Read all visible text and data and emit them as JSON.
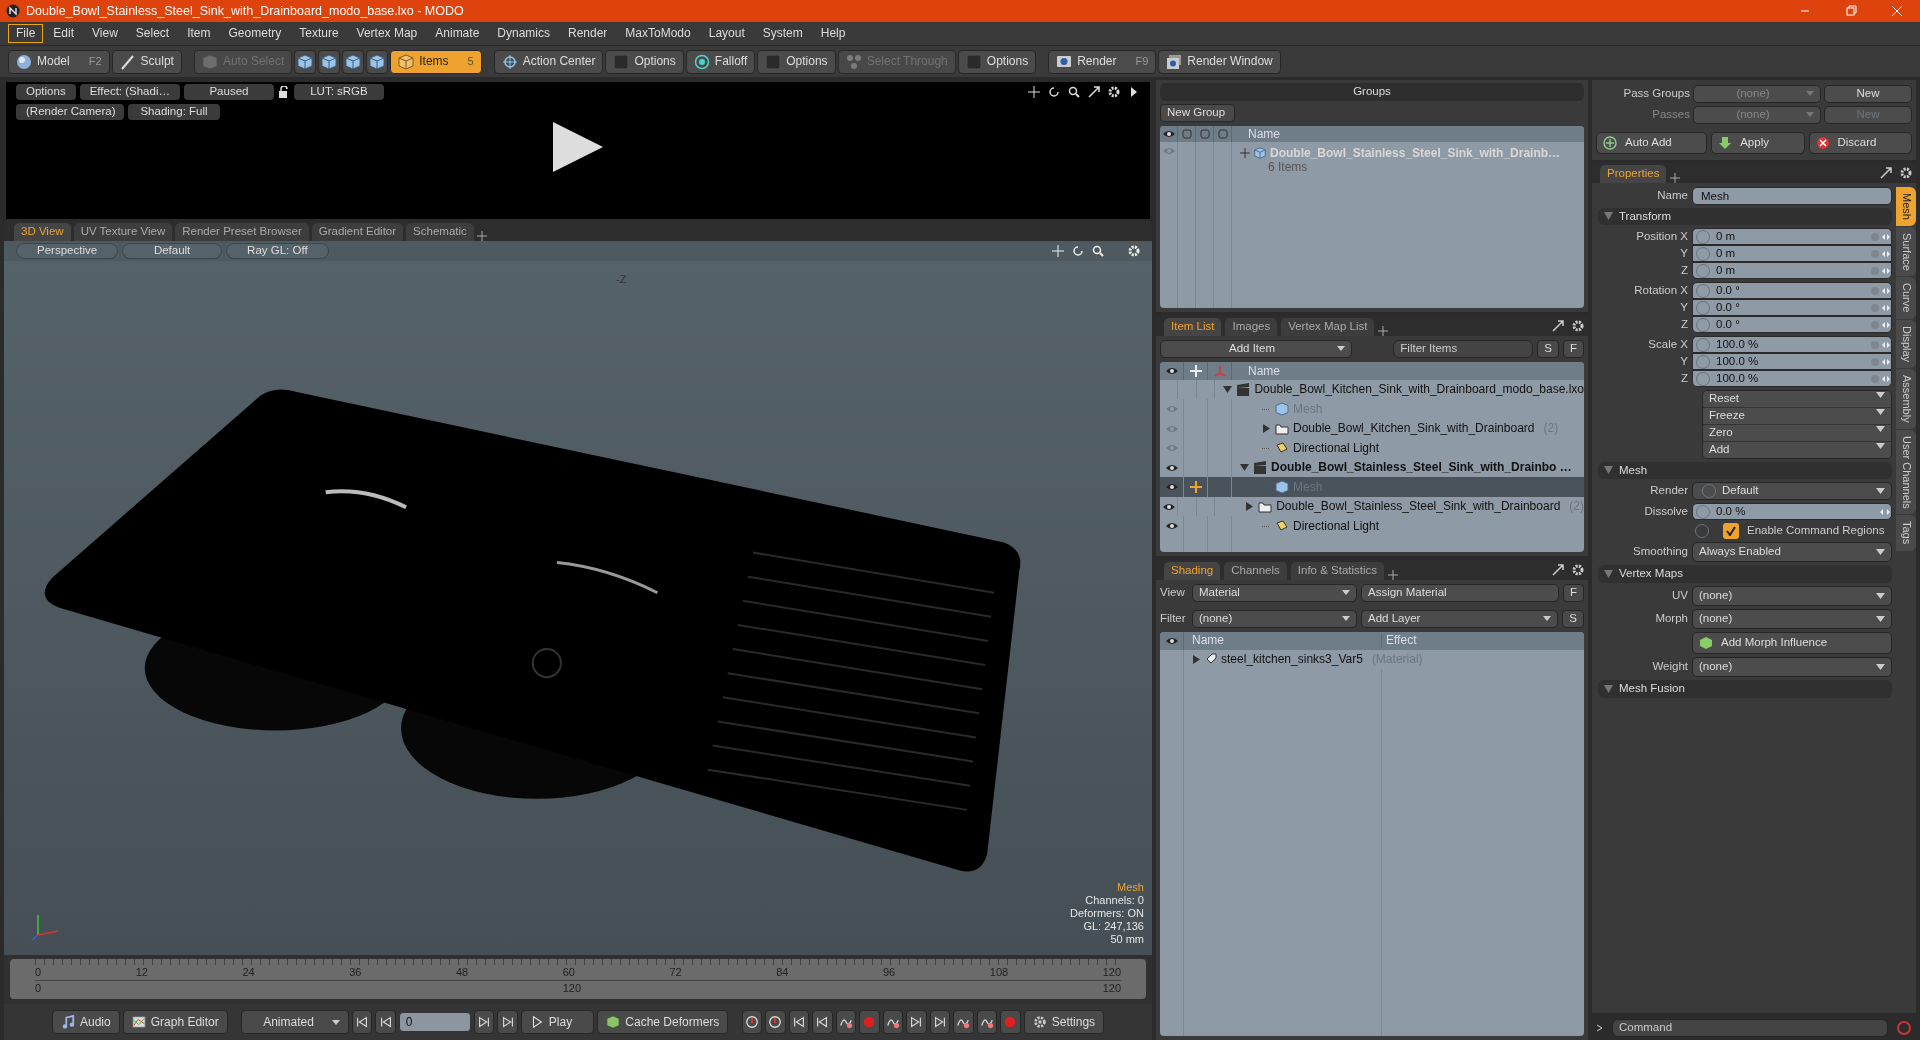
{
  "window": {
    "title": "Double_Bowl_Stainless_Steel_Sink_with_Drainboard_modo_base.lxo - MODO"
  },
  "menus": [
    {
      "label": "File",
      "selected": true
    },
    {
      "label": "Edit",
      "selected": false
    },
    {
      "label": "View",
      "selected": false
    },
    {
      "label": "Select",
      "selected": false
    },
    {
      "label": "Item",
      "selected": false
    },
    {
      "label": "Geometry",
      "selected": false
    },
    {
      "label": "Texture",
      "selected": false
    },
    {
      "label": "Vertex Map",
      "selected": false
    },
    {
      "label": "Animate",
      "selected": false
    },
    {
      "label": "Dynamics",
      "selected": false
    },
    {
      "label": "Render",
      "selected": false
    },
    {
      "label": "MaxToModo",
      "selected": false
    },
    {
      "label": "Layout",
      "selected": false
    },
    {
      "label": "System",
      "selected": false
    },
    {
      "label": "Help",
      "selected": false
    }
  ],
  "toolbar": [
    {
      "kind": "button",
      "label": "Model",
      "key": "F2",
      "selected": false,
      "disabled": false
    },
    {
      "kind": "button",
      "label": "Sculpt",
      "selected": false,
      "disabled": false
    },
    {
      "kind": "button",
      "label": "Auto Select",
      "selected": false,
      "disabled": true
    },
    {
      "kind": "icon",
      "selected": false,
      "disabled": false
    },
    {
      "kind": "icon",
      "selected": false,
      "disabled": false
    },
    {
      "kind": "icon",
      "selected": false,
      "disabled": false
    },
    {
      "kind": "icon",
      "selected": false,
      "disabled": false
    },
    {
      "kind": "button",
      "label": "Items",
      "key": "5",
      "selected": true,
      "disabled": false
    },
    {
      "kind": "button",
      "label": "Action Center",
      "selected": false,
      "disabled": false
    },
    {
      "kind": "button",
      "label": "Options",
      "selected": false,
      "disabled": false
    },
    {
      "kind": "button",
      "label": "Falloff",
      "selected": false,
      "disabled": false
    },
    {
      "kind": "button",
      "label": "Options",
      "selected": false,
      "disabled": false
    },
    {
      "kind": "button",
      "label": "Select Through",
      "selected": false,
      "disabled": true
    },
    {
      "kind": "button",
      "label": "Options",
      "selected": false,
      "disabled": false
    },
    {
      "kind": "button",
      "label": "Render",
      "key": "F9",
      "selected": false,
      "disabled": false
    },
    {
      "kind": "button",
      "label": "Render Window",
      "selected": false,
      "disabled": false
    }
  ],
  "preview": {
    "buttons_row1": [
      "Options",
      "Effect: (Shadi…",
      "Paused"
    ],
    "lut": "LUT: sRGB",
    "buttons_row2": [
      "(Render Camera)",
      "Shading: Full"
    ]
  },
  "viewport": {
    "tabs": [
      {
        "label": "3D View",
        "selected": true
      },
      {
        "label": "UV Texture View",
        "selected": false
      },
      {
        "label": "Render Preset Browser",
        "selected": false
      },
      {
        "label": "Gradient Editor",
        "selected": false
      },
      {
        "label": "Schematic",
        "selected": false
      }
    ],
    "buttons": [
      "Perspective",
      "Default",
      "Ray GL: Off"
    ],
    "axis_label": "-Z",
    "info": [
      "Mesh",
      "Channels: 0",
      "Deformers: ON",
      "GL: 247,136",
      "50 mm"
    ]
  },
  "timeline": {
    "ticks": [
      "0",
      "12",
      "24",
      "36",
      "48",
      "60",
      "72",
      "84",
      "96",
      "108",
      "120"
    ],
    "range": [
      "0",
      "120",
      "120"
    ]
  },
  "bottom_bar": [
    {
      "kind": "button",
      "label": "Audio"
    },
    {
      "kind": "button",
      "label": "Graph Editor"
    },
    {
      "kind": "dropdown",
      "label": "Animated"
    },
    {
      "kind": "icon"
    },
    {
      "kind": "icon"
    },
    {
      "kind": "field",
      "label": "0"
    },
    {
      "kind": "icon"
    },
    {
      "kind": "icon"
    },
    {
      "kind": "button",
      "label": "Play"
    },
    {
      "kind": "button",
      "label": "Cache Deformers"
    },
    {
      "kind": "icon"
    },
    {
      "kind": "icon"
    },
    {
      "kind": "icon"
    },
    {
      "kind": "icon"
    },
    {
      "kind": "icon"
    },
    {
      "kind": "icon"
    },
    {
      "kind": "icon"
    },
    {
      "kind": "icon"
    },
    {
      "kind": "icon"
    },
    {
      "kind": "icon"
    },
    {
      "kind": "icon"
    },
    {
      "kind": "icon"
    },
    {
      "kind": "button",
      "label": "Settings"
    }
  ],
  "groups": {
    "title": "Groups",
    "new_button": "New Group",
    "column": "Name",
    "rows": [
      {
        "name": "Double_Bowl_Stainless_Steel_Sink_with_Drainb…",
        "detail": "6 Items"
      }
    ]
  },
  "item_list": {
    "tabs": [
      {
        "label": "Item List",
        "selected": true
      },
      {
        "label": "Images",
        "selected": false
      },
      {
        "label": "Vertex Map List",
        "selected": false
      }
    ],
    "add_button": "Add Item",
    "filter_placeholder": "Filter Items",
    "s_button": "S",
    "f_button": "F",
    "column": "Name",
    "items": [
      {
        "kind": "scene",
        "name": "Double_Bowl_Kitchen_Sink_with_Drainboard_modo_base.lxo",
        "active": false,
        "expanded": true,
        "selected": false,
        "children": [
          {
            "kind": "mesh",
            "name": "Mesh",
            "visible": false,
            "hidden": true,
            "selected": false
          },
          {
            "kind": "folder",
            "name": "Double_Bowl_Kitchen_Sink_with_Drainboard",
            "count": "(2)",
            "visible": false,
            "hidden": false,
            "expanded": false,
            "selected": false
          },
          {
            "kind": "light",
            "name": "Directional Light",
            "visible": false,
            "hidden": false,
            "selected": false
          }
        ]
      },
      {
        "kind": "scene",
        "name": "Double_Bowl_Stainless_Steel_Sink_with_Drainbo …",
        "active": true,
        "expanded": true,
        "visible": true,
        "selected": false,
        "children": [
          {
            "kind": "mesh",
            "name": "Mesh",
            "visible": true,
            "hidden": true,
            "selected": true
          },
          {
            "kind": "folder",
            "name": "Double_Bowl_Stainless_Steel_Sink_with_Drainboard",
            "count": "(2)",
            "visible": true,
            "hidden": false,
            "expanded": false,
            "selected": false
          },
          {
            "kind": "light",
            "name": "Directional Light",
            "visible": true,
            "hidden": false,
            "selected": false
          }
        ]
      }
    ]
  },
  "shading": {
    "tabs": [
      {
        "label": "Shading",
        "selected": true
      },
      {
        "label": "Channels",
        "selected": false
      },
      {
        "label": "Info & Statistics",
        "selected": false
      }
    ],
    "view_label": "View",
    "view_value": "Material",
    "assign_button": "Assign Material",
    "f_button": "F",
    "filter_label": "Filter",
    "filter_value": "(none)",
    "layer_button": "Add Layer",
    "s_button": "S",
    "columns": [
      "Name",
      "Effect"
    ],
    "rows": [
      {
        "name": "steel_kitchen_sinks3_Var5",
        "type": "(Material)",
        "expanded": false
      }
    ]
  },
  "passes": {
    "rows": [
      {
        "label": "Pass Groups",
        "value": "(none)",
        "button": "New",
        "disabled": false
      },
      {
        "label": "Passes",
        "value": "(none)",
        "button": "New",
        "disabled": true
      }
    ],
    "buttons": [
      "Auto Add",
      "Apply",
      "Discard"
    ]
  },
  "properties": {
    "tab": "Properties",
    "name_label": "Name",
    "name_value": "Mesh",
    "sections": [
      {
        "title": "Transform",
        "rows": [
          {
            "kind": "vector",
            "labels": [
              "Position X",
              "Y",
              "Z"
            ],
            "values": [
              "0 m",
              "0 m",
              "0 m"
            ]
          },
          {
            "kind": "vector",
            "labels": [
              "Rotation X",
              "Y",
              "Z"
            ],
            "values": [
              "0.0 °",
              "0.0 °",
              "0.0 °"
            ]
          },
          {
            "kind": "vector",
            "labels": [
              "Scale X",
              "Y",
              "Z"
            ],
            "values": [
              "100.0 %",
              "100.0 %",
              "100.0 %"
            ]
          },
          {
            "kind": "menus",
            "items": [
              "Reset",
              "Freeze",
              "Zero",
              "Add"
            ]
          }
        ]
      },
      {
        "title": "Mesh",
        "rows": [
          {
            "kind": "dropdown",
            "label": "Render",
            "value": "Default",
            "channel": true
          },
          {
            "kind": "value",
            "label": "Dissolve",
            "value": "0.0 %"
          },
          {
            "kind": "checkbox",
            "label": "Enable Command Regions",
            "checked": true
          },
          {
            "kind": "dropdown",
            "label": "Smoothing",
            "value": "Always Enabled",
            "channel": false
          }
        ]
      },
      {
        "title": "Vertex Maps",
        "rows": [
          {
            "kind": "dropdown",
            "label": "UV",
            "value": "(none)",
            "channel": false
          },
          {
            "kind": "dropdown",
            "label": "Morph",
            "value": "(none)",
            "channel": false
          },
          {
            "kind": "button",
            "label": "Add Morph Influence"
          },
          {
            "kind": "dropdown",
            "label": "Weight",
            "value": "(none)",
            "channel": false
          }
        ]
      },
      {
        "title": "Mesh Fusion"
      }
    ],
    "side_tabs": [
      {
        "label": "Mesh",
        "selected": true
      },
      {
        "label": "Surface",
        "selected": false
      },
      {
        "label": "Curve",
        "selected": false
      },
      {
        "label": "Display",
        "selected": false
      },
      {
        "label": "Assembly",
        "selected": false
      },
      {
        "label": "User Channels",
        "selected": false
      },
      {
        "label": "Tags",
        "selected": false
      }
    ]
  },
  "command": {
    "placeholder": "Command"
  }
}
